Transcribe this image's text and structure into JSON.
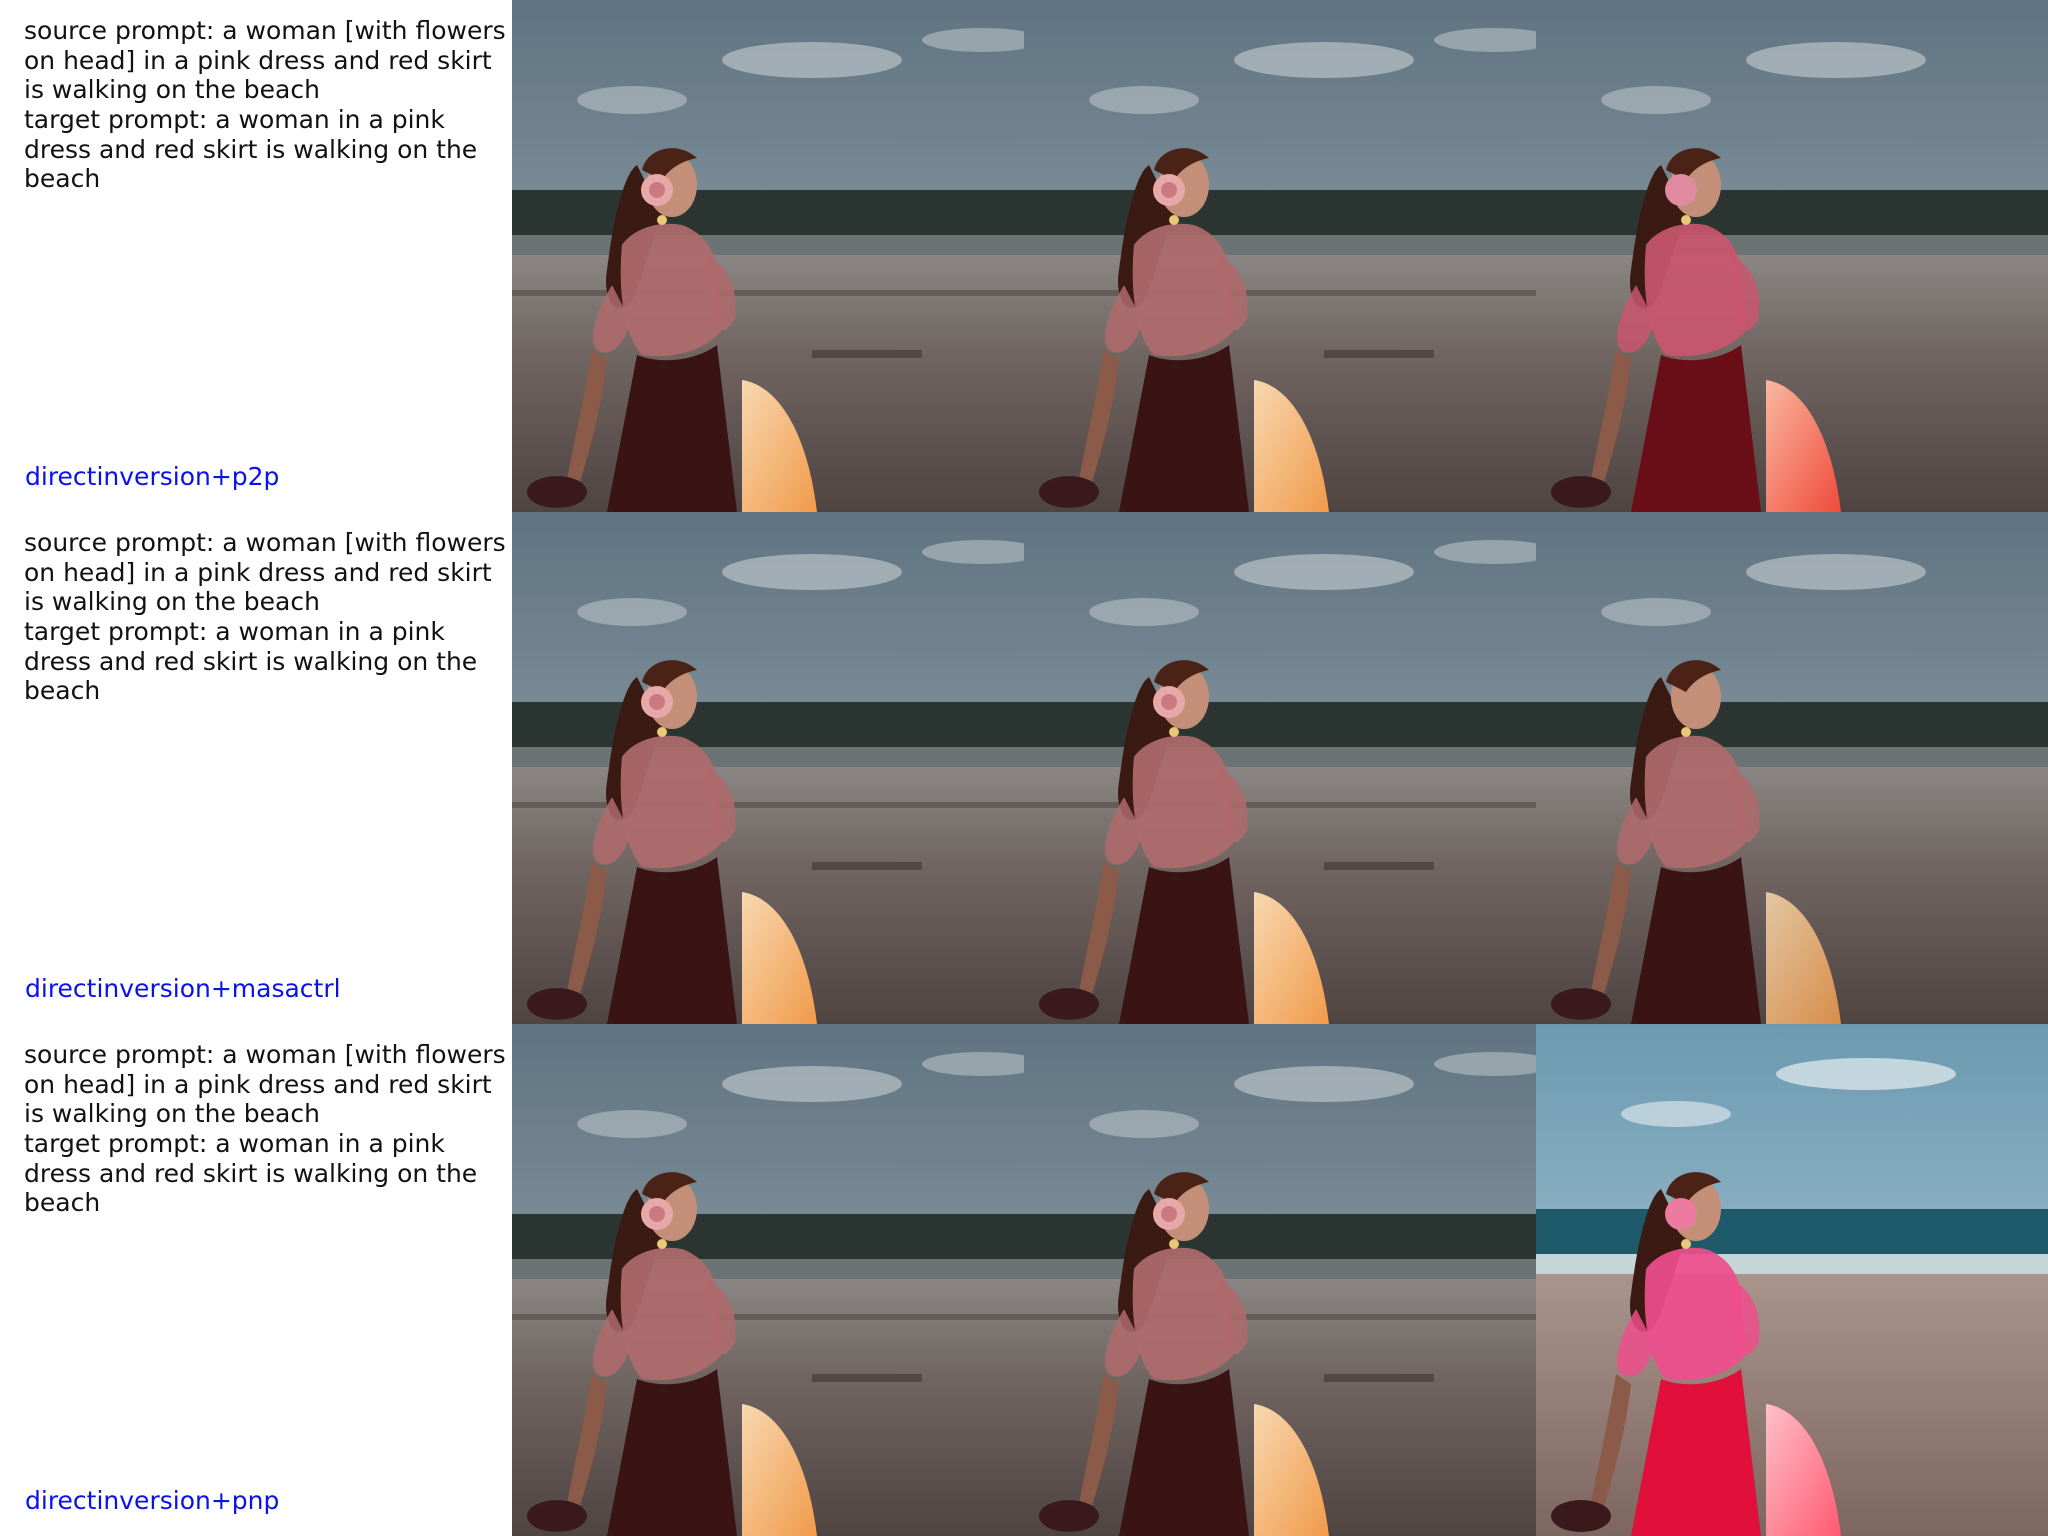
{
  "rows": [
    {
      "source_prompt": "source prompt: a woman [with flowers on head] in a pink dress and red skirt is walking on the beach",
      "target_prompt": "target prompt: a woman in a pink dress and red skirt is walking on the beach",
      "method": "directinversion+p2p"
    },
    {
      "source_prompt": "source prompt: a woman [with flowers on head] in a pink dress and red skirt is walking on the beach",
      "target_prompt": "target prompt: a woman in a pink dress and red skirt is walking on the beach",
      "method": "directinversion+masactrl"
    },
    {
      "source_prompt": "source prompt: a woman [with flowers on head] in a pink dress and red skirt is walking on the beach",
      "target_prompt": "target prompt: a woman in a pink dress and red skirt is walking on the beach",
      "method": "directinversion+pnp"
    }
  ],
  "colors": {
    "method_label": "#0a10ee",
    "prompt_text": "#111111"
  }
}
